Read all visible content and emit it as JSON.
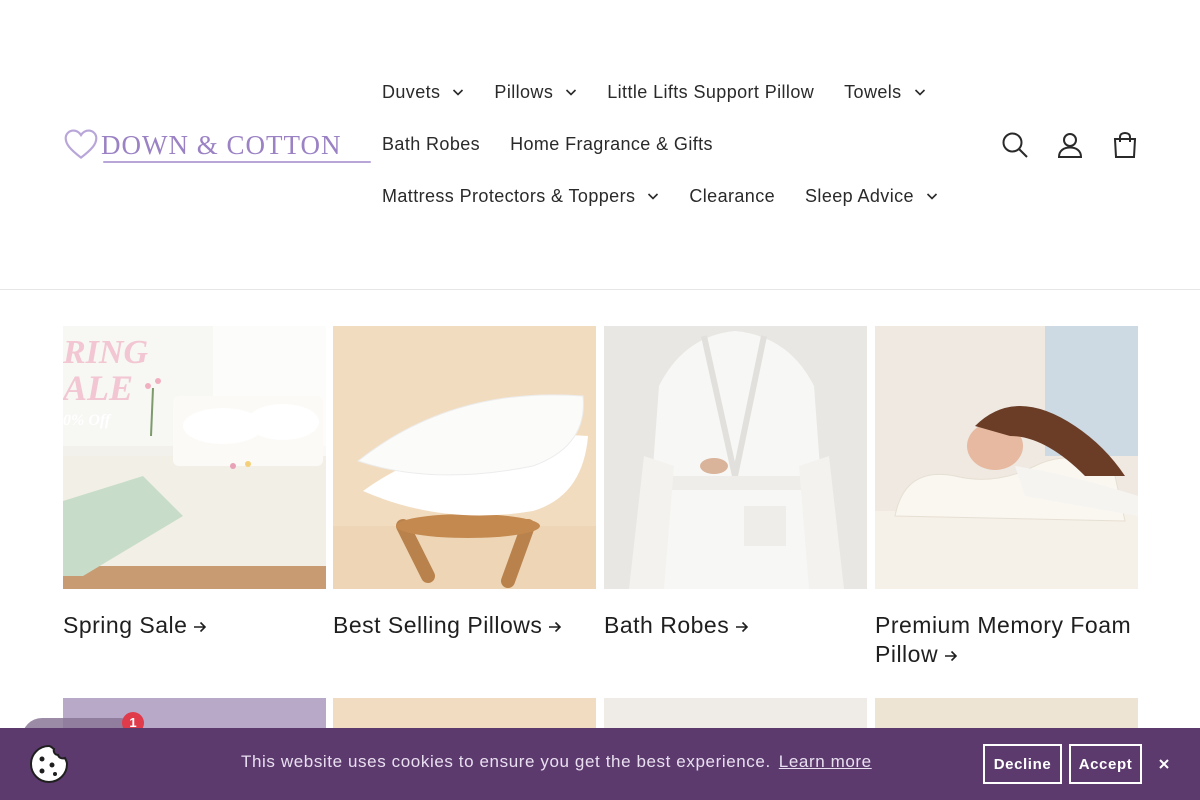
{
  "brand": {
    "name": "DOWN & COTTON",
    "color": "#9b82c4"
  },
  "nav": {
    "rows": [
      [
        {
          "label": "Duvets",
          "has_dropdown": true
        },
        {
          "label": "Pillows",
          "has_dropdown": true
        },
        {
          "label": "Little Lifts Support Pillow",
          "has_dropdown": false
        },
        {
          "label": "Towels",
          "has_dropdown": true
        }
      ],
      [
        {
          "label": "Bath Robes",
          "has_dropdown": false
        },
        {
          "label": "Home Fragrance & Gifts",
          "has_dropdown": false
        }
      ],
      [
        {
          "label": "Mattress Protectors & Toppers",
          "has_dropdown": true
        },
        {
          "label": "Clearance",
          "has_dropdown": false
        },
        {
          "label": "Sleep Advice",
          "has_dropdown": true
        }
      ]
    ]
  },
  "header_icons": [
    "search-icon",
    "account-icon",
    "cart-icon"
  ],
  "collections": [
    {
      "title": "Spring Sale",
      "image_text": [
        "RING",
        "ALE",
        "0% Off"
      ],
      "image": "bedroom-sale"
    },
    {
      "title": "Best Selling Pillows",
      "image": "pillows-on-stool"
    },
    {
      "title": "Bath Robes",
      "image": "white-bathrobe"
    },
    {
      "title": "Premium Memory Foam Pillow",
      "image": "woman-sleeping-memory-foam"
    }
  ],
  "cookie": {
    "message": "This website uses cookies to ensure you get the best experience.",
    "learn_more": "Learn more",
    "decline": "Decline",
    "accept": "Accept",
    "background": "#5c3a6e"
  },
  "chat": {
    "badge_count": "1"
  }
}
